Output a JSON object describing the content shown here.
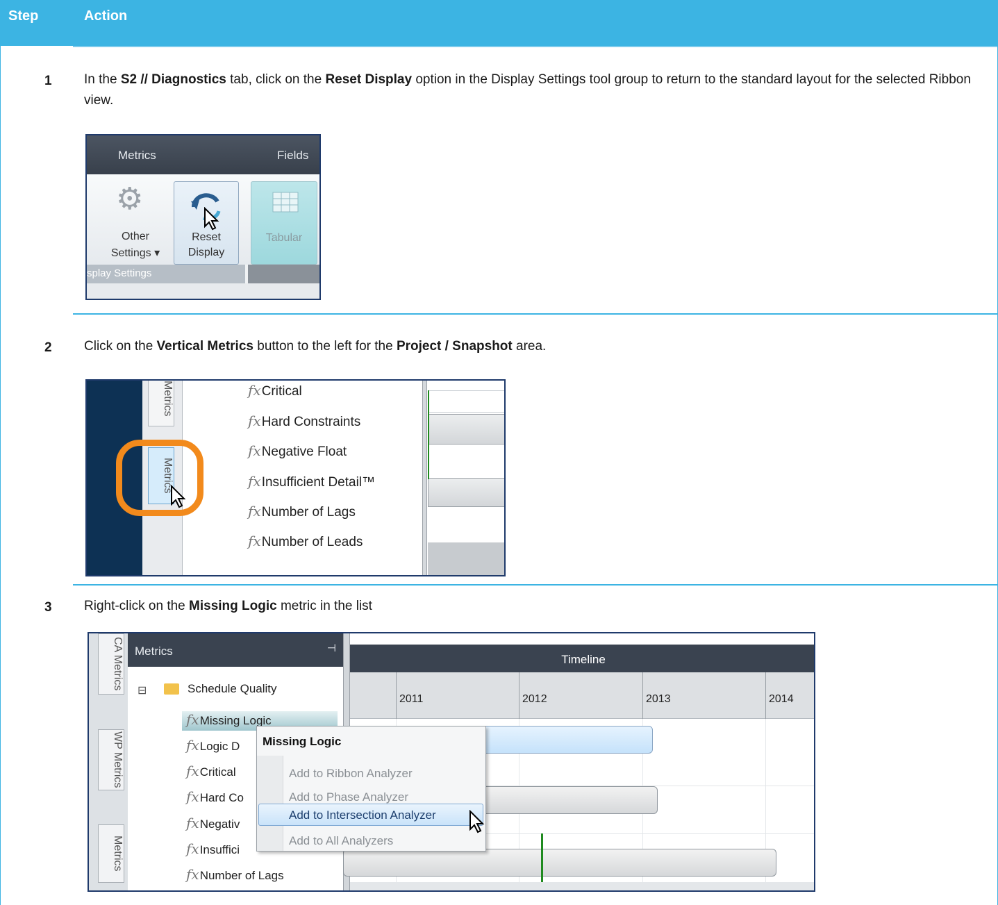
{
  "header": {
    "step_label": "Step",
    "action_label": "Action"
  },
  "steps": [
    {
      "number": "1",
      "text_parts": [
        "In the ",
        "S2 // Diagnostics",
        " tab, click on the ",
        "Reset Display",
        " option in the Display Settings tool group to return to the standard layout for the selected Ribbon view."
      ],
      "ribbon": {
        "metrics_tab": "Metrics",
        "fields_tab": "Fields",
        "other_settings_line1": "Other",
        "other_settings_line2": "Settings ▾",
        "reset_line1": "Reset",
        "reset_line2": "Display",
        "tabular": "Tabular",
        "group_label": "splay Settings"
      }
    },
    {
      "number": "2",
      "text_parts": [
        "Click on the ",
        "Vertical Metrics",
        " button to the left for the ",
        "Project / Snapshot",
        " area."
      ],
      "vertical_panel": {
        "tab_top": "Metrics",
        "tab_active": "Metrics",
        "items": [
          "Critical",
          "Hard Constraints",
          "Negative Float",
          "Insufficient Detail™",
          "Number of Lags",
          "Number of Leads"
        ]
      }
    },
    {
      "number": "3",
      "text_parts": [
        "Right-click on the ",
        "Missing Logic",
        " metric in the list"
      ],
      "metrics_panel": {
        "side_tabs": [
          "CA Metrics",
          "WP Metrics",
          "Metrics"
        ],
        "panel_title": "Metrics",
        "folder": "Schedule Quality",
        "items": [
          "Missing Logic",
          "Logic D",
          "Critical",
          "Hard Co",
          "Negativ",
          "Insuffici",
          "Number of Lags"
        ],
        "timeline_title": "Timeline",
        "years": [
          "2011",
          "2012",
          "2013",
          "2014"
        ]
      },
      "context_menu": {
        "title": "Missing Logic",
        "items": [
          "Add to Ribbon Analyzer",
          "Add to Phase Analyzer",
          "Add to Intersection Analyzer",
          "Add to All Analyzers"
        ],
        "highlighted_index": 2
      }
    }
  ],
  "icons": {
    "gear": "gear-icon",
    "reset": "reset-icon",
    "table": "table-icon",
    "folder": "folder-icon",
    "function": "fx-icon",
    "pin": "pin-icon",
    "cursor": "cursor-icon"
  },
  "colors": {
    "header": "#3cb4e3",
    "highlight_ring": "#f28a1c"
  }
}
